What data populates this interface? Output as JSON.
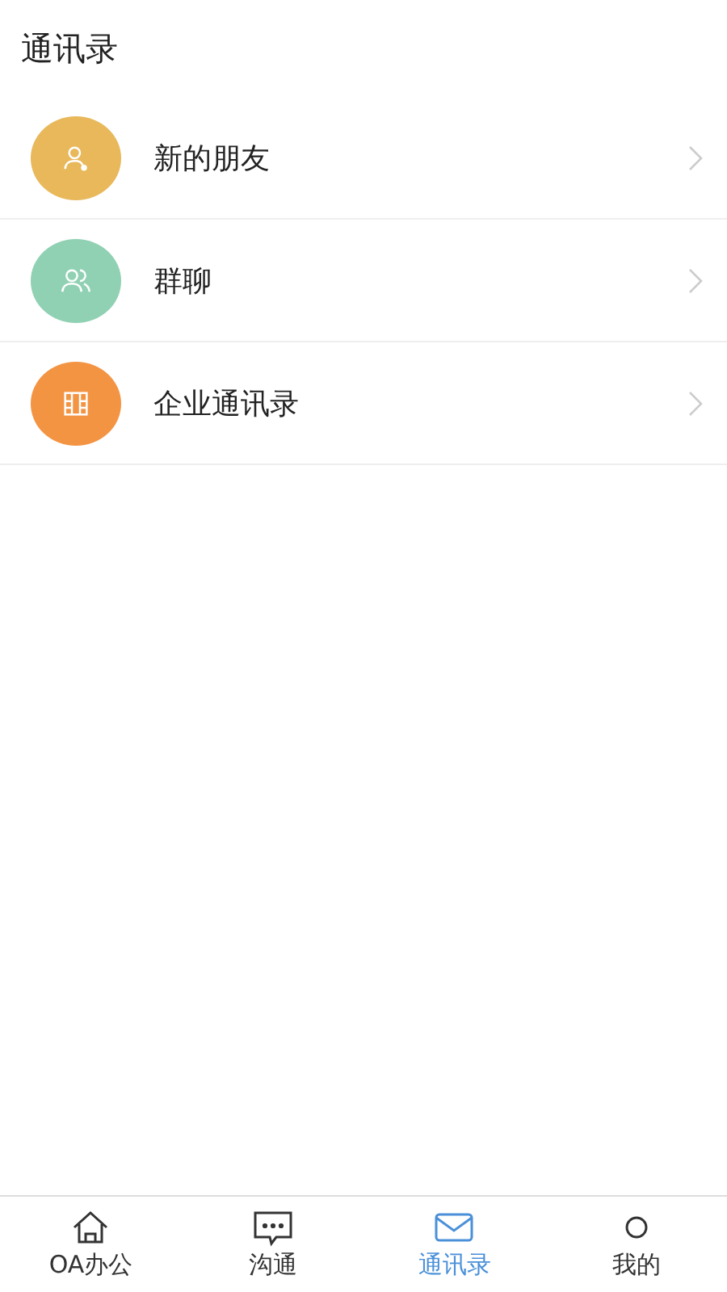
{
  "header": {
    "title": "通讯录"
  },
  "items": [
    {
      "label": "新的朋友",
      "kind": "friend",
      "color": "#e8b85a"
    },
    {
      "label": "群聊",
      "kind": "group",
      "color": "#90d1b3"
    },
    {
      "label": "企业通讯录",
      "kind": "company",
      "color": "#f39443"
    }
  ],
  "tabs": [
    {
      "label": "OA办公",
      "kind": "home",
      "selected": false
    },
    {
      "label": "沟通",
      "kind": "chat",
      "selected": false
    },
    {
      "label": "通讯录",
      "kind": "mail",
      "selected": true
    },
    {
      "label": "我的",
      "kind": "me",
      "selected": false
    }
  ]
}
